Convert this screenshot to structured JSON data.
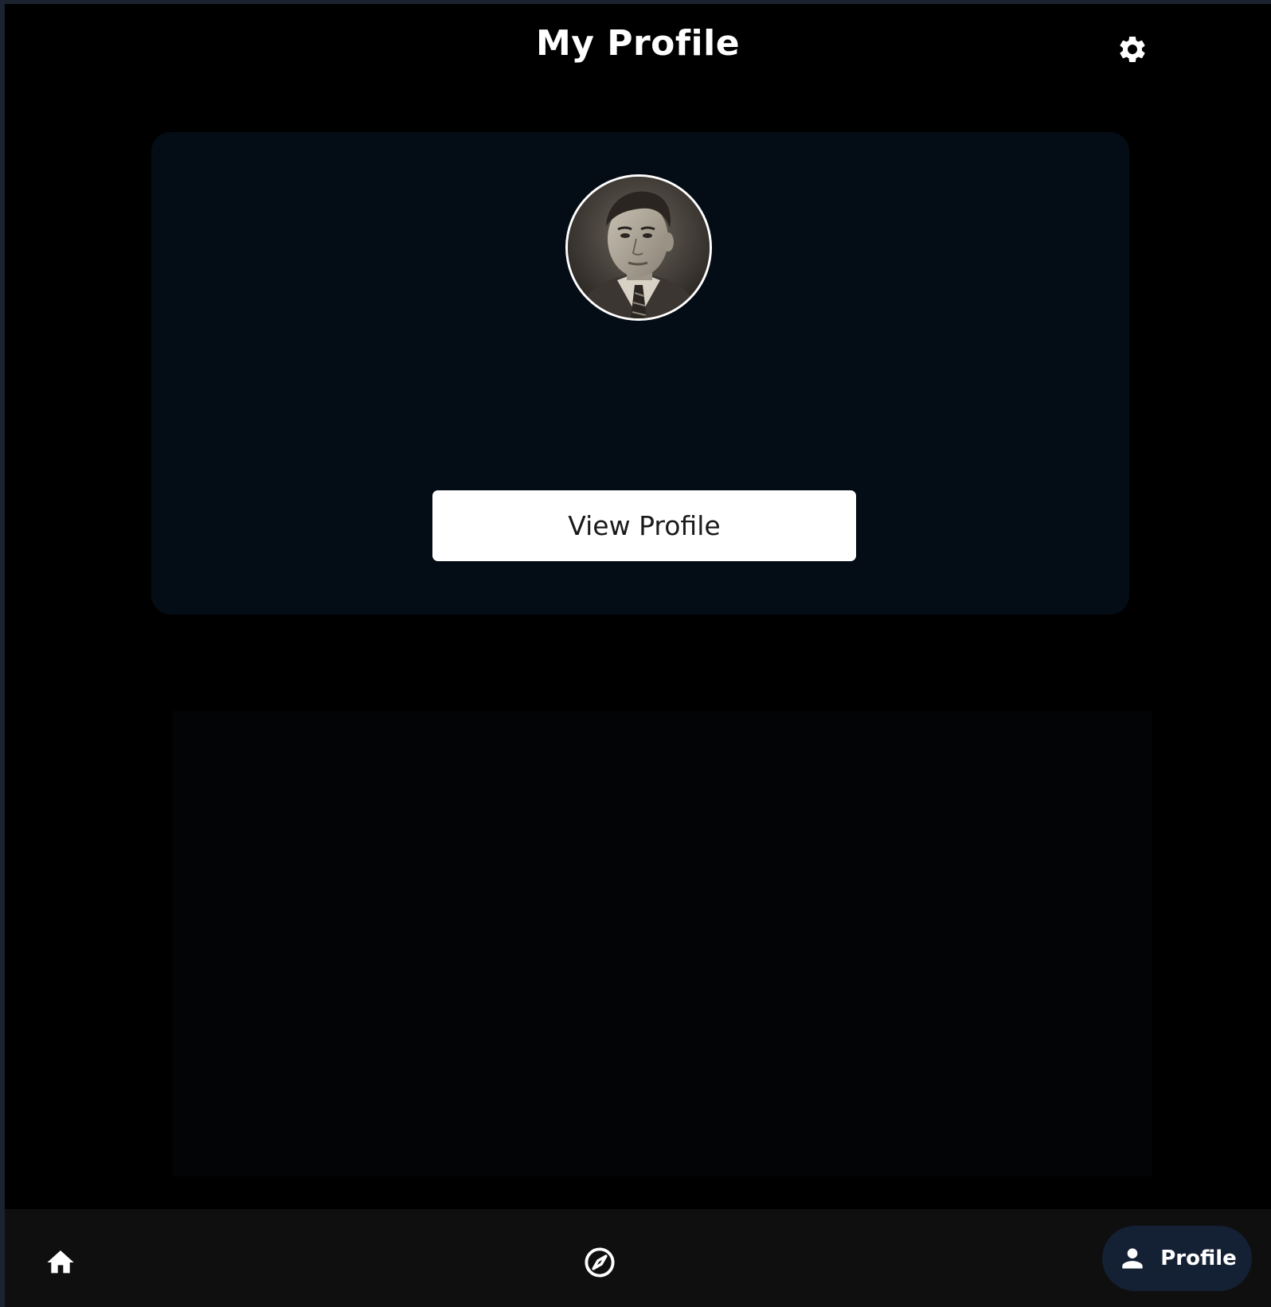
{
  "header": {
    "title": "My Profile",
    "settings_icon": "gear-icon"
  },
  "profile_card": {
    "avatar_alt": "profile photo",
    "view_profile_label": "View Profile"
  },
  "bottom_nav": {
    "items": [
      {
        "icon": "home-icon",
        "label": ""
      },
      {
        "icon": "compass-icon",
        "label": ""
      },
      {
        "icon": "person-icon",
        "label": "Profile",
        "active": true
      }
    ]
  },
  "colors": {
    "background": "#000000",
    "card": "#040c15",
    "nav_bar": "#0f0f0f",
    "active_pill": "#142033",
    "button": "#ffffff"
  }
}
